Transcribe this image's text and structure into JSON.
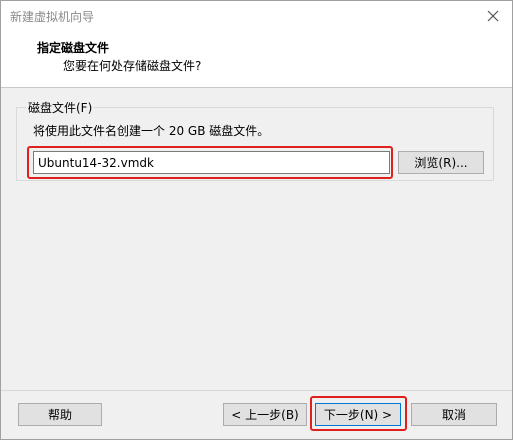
{
  "window": {
    "title": "新建虚拟机向导"
  },
  "header": {
    "title": "指定磁盘文件",
    "subtitle": "您要在何处存储磁盘文件?"
  },
  "disk_file": {
    "group_label": "磁盘文件(F)",
    "description": "将使用此文件名创建一个 20 GB 磁盘文件。",
    "file_name": "Ubuntu14-32.vmdk",
    "browse_label": "浏览(R)..."
  },
  "footer": {
    "help_label": "帮助",
    "back_label": "< 上一步(B)",
    "next_label": "下一步(N) >",
    "cancel_label": "取消"
  },
  "colors": {
    "highlight": "#e0201c",
    "focus_border": "#0078d7"
  },
  "icons": {
    "close": "close-icon"
  }
}
